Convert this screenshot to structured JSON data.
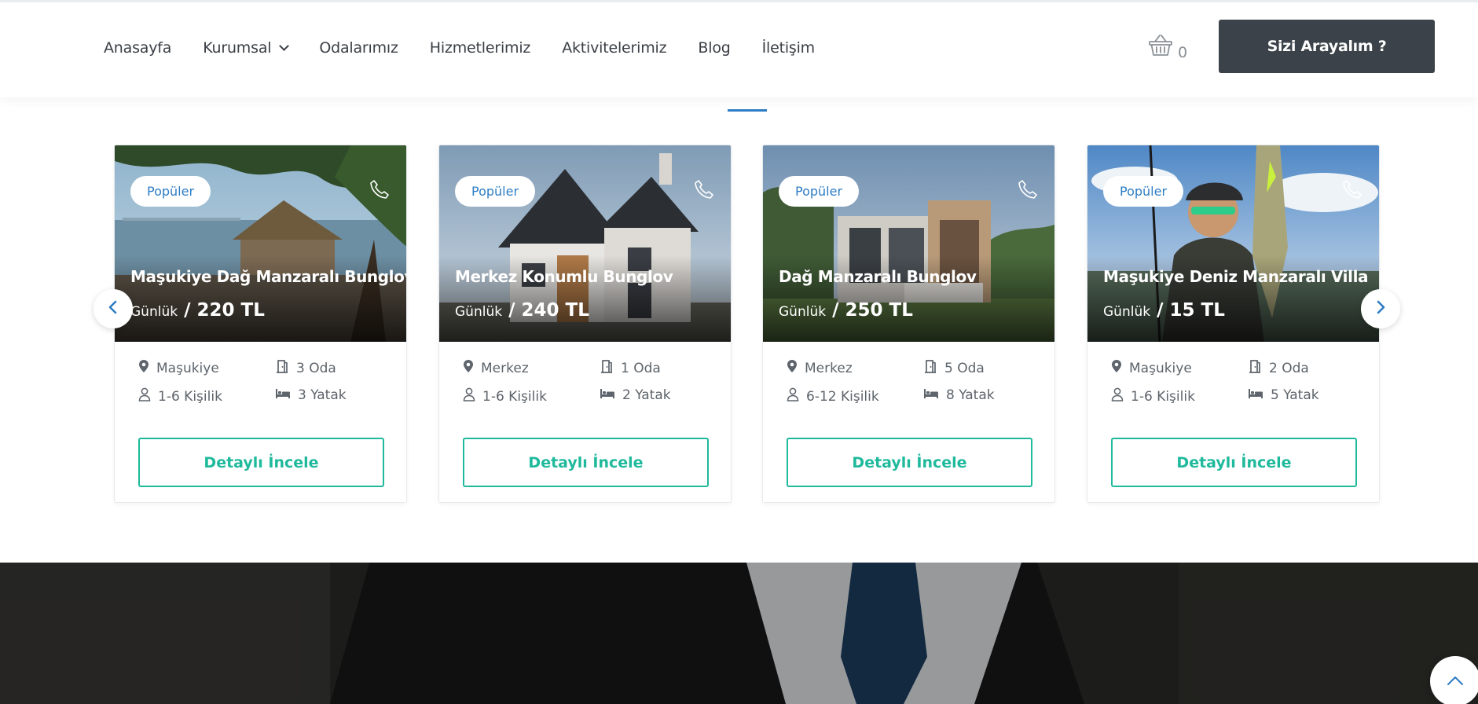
{
  "nav": {
    "items": [
      "Anasayfa",
      "Kurumsal",
      "Odalarımız",
      "Hizmetlerimiz",
      "Aktivitelerimiz",
      "Blog",
      "İletişim"
    ]
  },
  "header": {
    "cart_icon": "basket-icon",
    "cart_count": "0",
    "call_button": "Sizi Arayalım ?"
  },
  "cards": [
    {
      "badge": "Popüler",
      "title": "Maşukiye Dağ Manzaralı Bunglov",
      "price_unit": "Günlük",
      "price": "/ 220 TL",
      "location": "Maşukiye",
      "rooms": "3 Oda",
      "guests": "1-6 Kişilik",
      "beds": "3 Yatak",
      "button": "Detaylı İncele"
    },
    {
      "badge": "Popüler",
      "title": "Merkez Konumlu Bunglov",
      "price_unit": "Günlük",
      "price": "/ 240 TL",
      "location": "Merkez",
      "rooms": "1 Oda",
      "guests": "1-6 Kişilik",
      "beds": "2 Yatak",
      "button": "Detaylı İncele"
    },
    {
      "badge": "Popüler",
      "title": "Dağ Manzaralı Bunglov",
      "price_unit": "Günlük",
      "price": "/ 250 TL",
      "location": "Merkez",
      "rooms": "5 Oda",
      "guests": "6-12 Kişilik",
      "beds": "8 Yatak",
      "button": "Detaylı İncele"
    },
    {
      "badge": "Popüler",
      "title": "Maşukiye Deniz Manzaralı Villa",
      "price_unit": "Günlük",
      "price": "/ 15 TL",
      "location": "Maşukiye",
      "rooms": "2 Oda",
      "guests": "1-6 Kişilik",
      "beds": "5 Yatak",
      "button": "Detaylı İncele"
    }
  ],
  "colors": {
    "accent_blue": "#2d7dc4",
    "accent_green": "#1fb99c",
    "dark_button": "#3b4249"
  }
}
